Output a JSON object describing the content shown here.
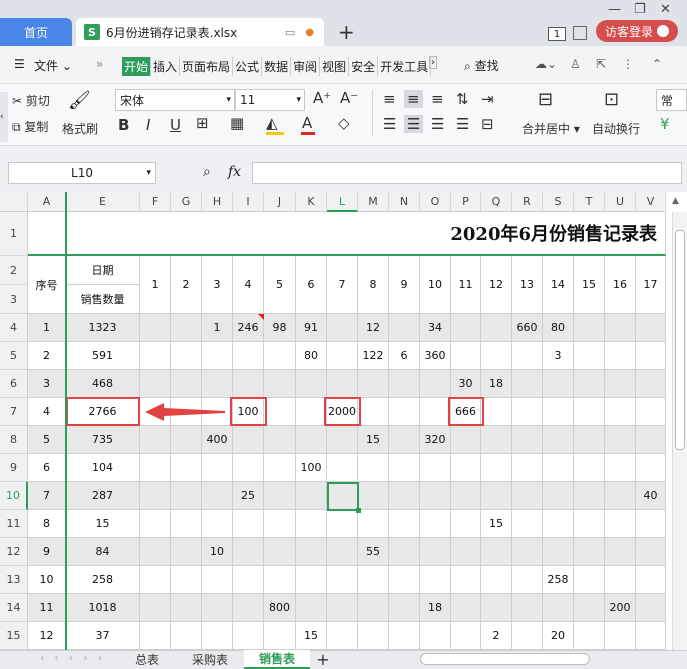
{
  "tabs": {
    "home": "首页",
    "file": "6月份进销存记录表.xlsx",
    "badge": "1",
    "login": "访客登录"
  },
  "menu": {
    "file": "文件",
    "items": [
      "开始",
      "插入",
      "页面布局",
      "公式",
      "数据",
      "审阅",
      "视图",
      "安全",
      "开发工具"
    ],
    "search": "查找"
  },
  "ribbon": {
    "cut": "剪切",
    "copy": "复制",
    "format_painter": "格式刷",
    "font_name": "宋体",
    "font_size": "11",
    "merge": "合并居中",
    "wrap": "自动换行",
    "normal": "常"
  },
  "formula": {
    "cell_ref": "L10",
    "fx": "fx"
  },
  "grid": {
    "title": "2020年6月份销售记录表",
    "col_letters": [
      "A",
      "E",
      "F",
      "G",
      "H",
      "I",
      "J",
      "K",
      "L",
      "M",
      "N",
      "O",
      "P",
      "Q",
      "R",
      "S",
      "T",
      "U",
      "V"
    ],
    "row_numbers": [
      "1",
      "2",
      "3",
      "4",
      "5",
      "6",
      "7",
      "8",
      "9",
      "10",
      "11",
      "12",
      "13",
      "14",
      "15"
    ],
    "header": {
      "seq": "序号",
      "date": "日期",
      "sales": "销售数量",
      "days": [
        "1",
        "2",
        "3",
        "4",
        "5",
        "6",
        "7",
        "8",
        "9",
        "10",
        "11",
        "12",
        "13",
        "14",
        "15",
        "16",
        "17"
      ]
    },
    "rows": [
      {
        "seq": "1",
        "total": "1323",
        "days": {
          "3": "1",
          "4": "246",
          "5": "98",
          "6": "91",
          "8": "12",
          "10": "34",
          "13": "660",
          "14": "80"
        }
      },
      {
        "seq": "2",
        "total": "591",
        "days": {
          "6": "80",
          "8": "122",
          "9": "6",
          "10": "360",
          "14": "3"
        }
      },
      {
        "seq": "3",
        "total": "468",
        "days": {
          "11": "30",
          "12": "18"
        }
      },
      {
        "seq": "4",
        "total": "2766",
        "days": {
          "4": "100",
          "7": "2000",
          "11": "666"
        }
      },
      {
        "seq": "5",
        "total": "735",
        "days": {
          "3": "400",
          "8": "15",
          "10": "320"
        }
      },
      {
        "seq": "6",
        "total": "104",
        "days": {
          "6": "100"
        }
      },
      {
        "seq": "7",
        "total": "287",
        "days": {
          "4": "25",
          "17": "40"
        }
      },
      {
        "seq": "8",
        "total": "15",
        "days": {
          "12": "15"
        }
      },
      {
        "seq": "9",
        "total": "84",
        "days": {
          "3": "10",
          "8": "55"
        }
      },
      {
        "seq": "10",
        "total": "258",
        "days": {
          "14": "258"
        }
      },
      {
        "seq": "11",
        "total": "1018",
        "days": {
          "5": "800",
          "10": "18",
          "16": "200"
        }
      },
      {
        "seq": "12",
        "total": "37",
        "days": {
          "6": "15",
          "12": "2",
          "14": "20"
        }
      }
    ]
  },
  "sheets": [
    "总表",
    "采购表",
    "销售表"
  ]
}
